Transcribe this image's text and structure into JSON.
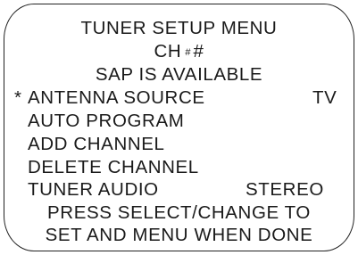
{
  "menu": {
    "title": "TUNER SETUP MENU",
    "channel_prefix": "CH",
    "channel_digit_1": "#",
    "channel_digit_2": "#",
    "sap_status": "SAP IS AVAILABLE",
    "items": [
      {
        "marker": "*",
        "label": "ANTENNA SOURCE",
        "value": "TV",
        "selected": true
      },
      {
        "marker": "",
        "label": "AUTO PROGRAM",
        "value": "",
        "selected": false
      },
      {
        "marker": "",
        "label": "ADD CHANNEL",
        "value": "",
        "selected": false
      },
      {
        "marker": "",
        "label": "DELETE CHANNEL",
        "value": "",
        "selected": false
      },
      {
        "marker": "",
        "label": "TUNER AUDIO",
        "value": "STEREO",
        "selected": false
      }
    ],
    "instructions_line_1": "PRESS SELECT/CHANGE TO",
    "instructions_line_2": "SET AND MENU WHEN DONE"
  },
  "colors": {
    "text": "#1a1a1a",
    "border": "#222222",
    "background": "#ffffff"
  }
}
